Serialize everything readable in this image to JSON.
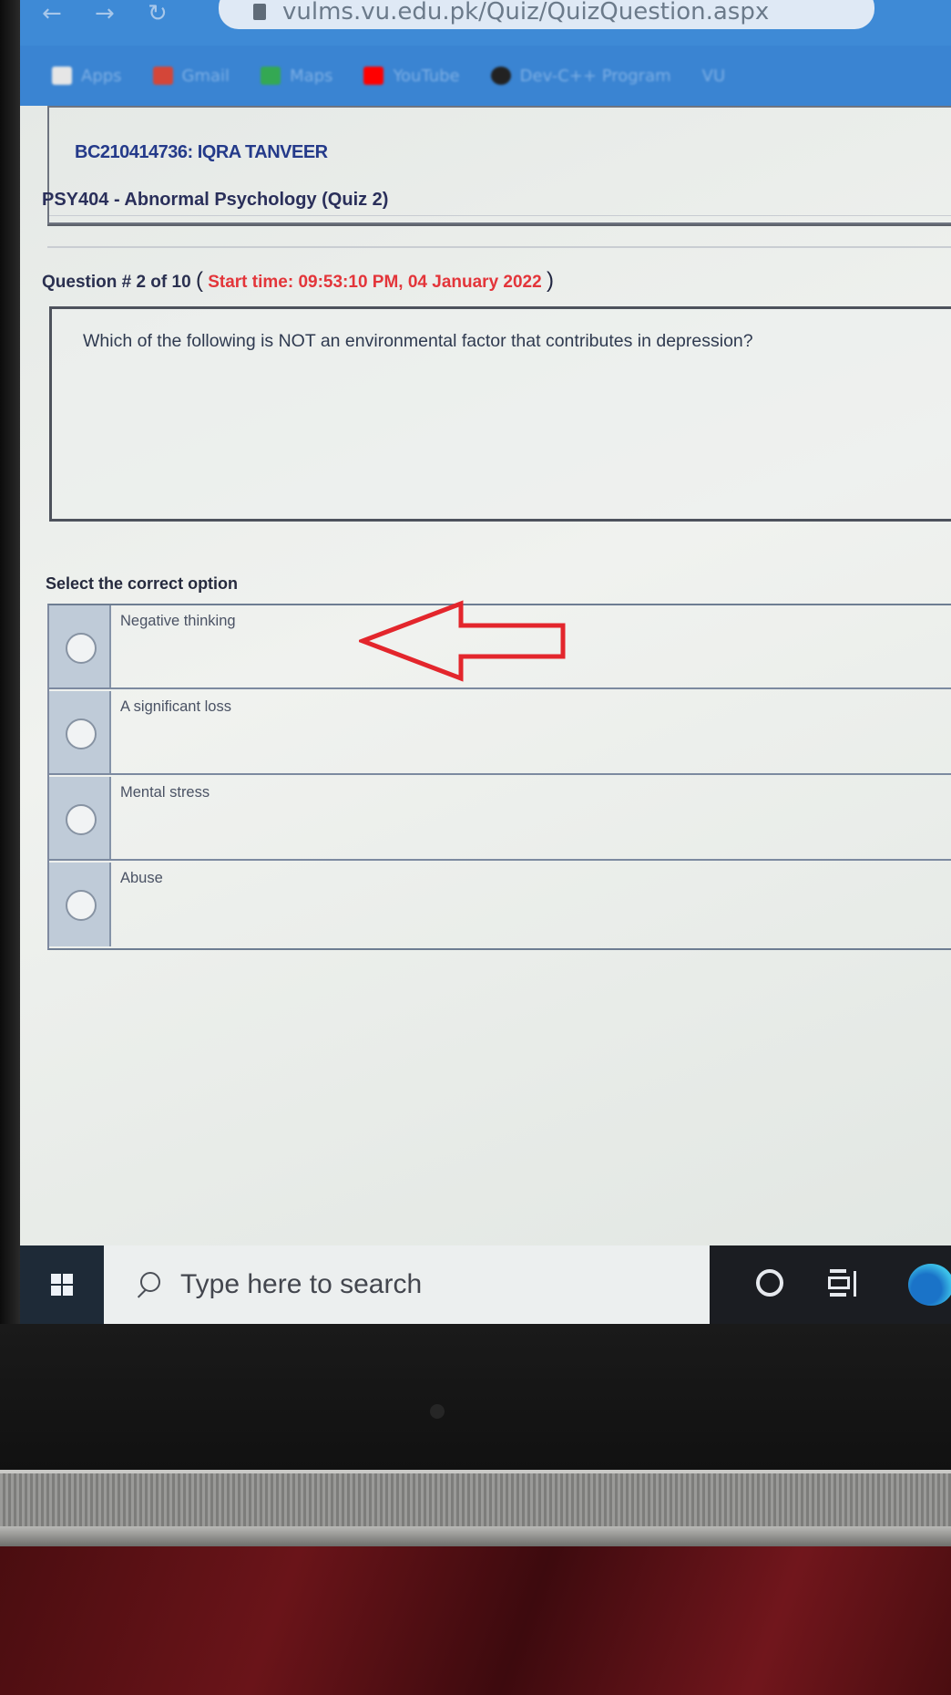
{
  "browser": {
    "url": "vulms.vu.edu.pk/Quiz/QuizQuestion.aspx",
    "bookmarks": [
      {
        "label": "Apps",
        "icon": "apps-grid-icon",
        "color": "#e6e6e6"
      },
      {
        "label": "Gmail",
        "icon": "gmail-icon",
        "color": "#d44638"
      },
      {
        "label": "Maps",
        "icon": "maps-icon",
        "color": "#34a853"
      },
      {
        "label": "YouTube",
        "icon": "youtube-icon",
        "color": "#ff0000"
      },
      {
        "label": "Dev-C++ Program",
        "icon": "devcpp-icon",
        "color": "#222222"
      },
      {
        "label": "VU",
        "icon": "vu-icon",
        "color": "#e6e6e6"
      }
    ]
  },
  "quiz": {
    "student": "BC210414736: IQRA TANVEER",
    "course": "PSY404 - Abnormal Psychology (Quiz 2)",
    "question_label": "Question # 2 of 10",
    "open_paren": "(",
    "start_time": "Start time: 09:53:10 PM, 04 January 2022",
    "close_paren": ")",
    "question_text": "Which of the following is NOT an environmental factor that contributes in depression?",
    "select_label": "Select the correct option",
    "options": [
      {
        "label": "Negative thinking"
      },
      {
        "label": "A significant loss"
      },
      {
        "label": "Mental stress"
      },
      {
        "label": "Abuse"
      }
    ],
    "annotation_color": "#e3262c"
  },
  "taskbar": {
    "search_placeholder": "Type here to search"
  }
}
